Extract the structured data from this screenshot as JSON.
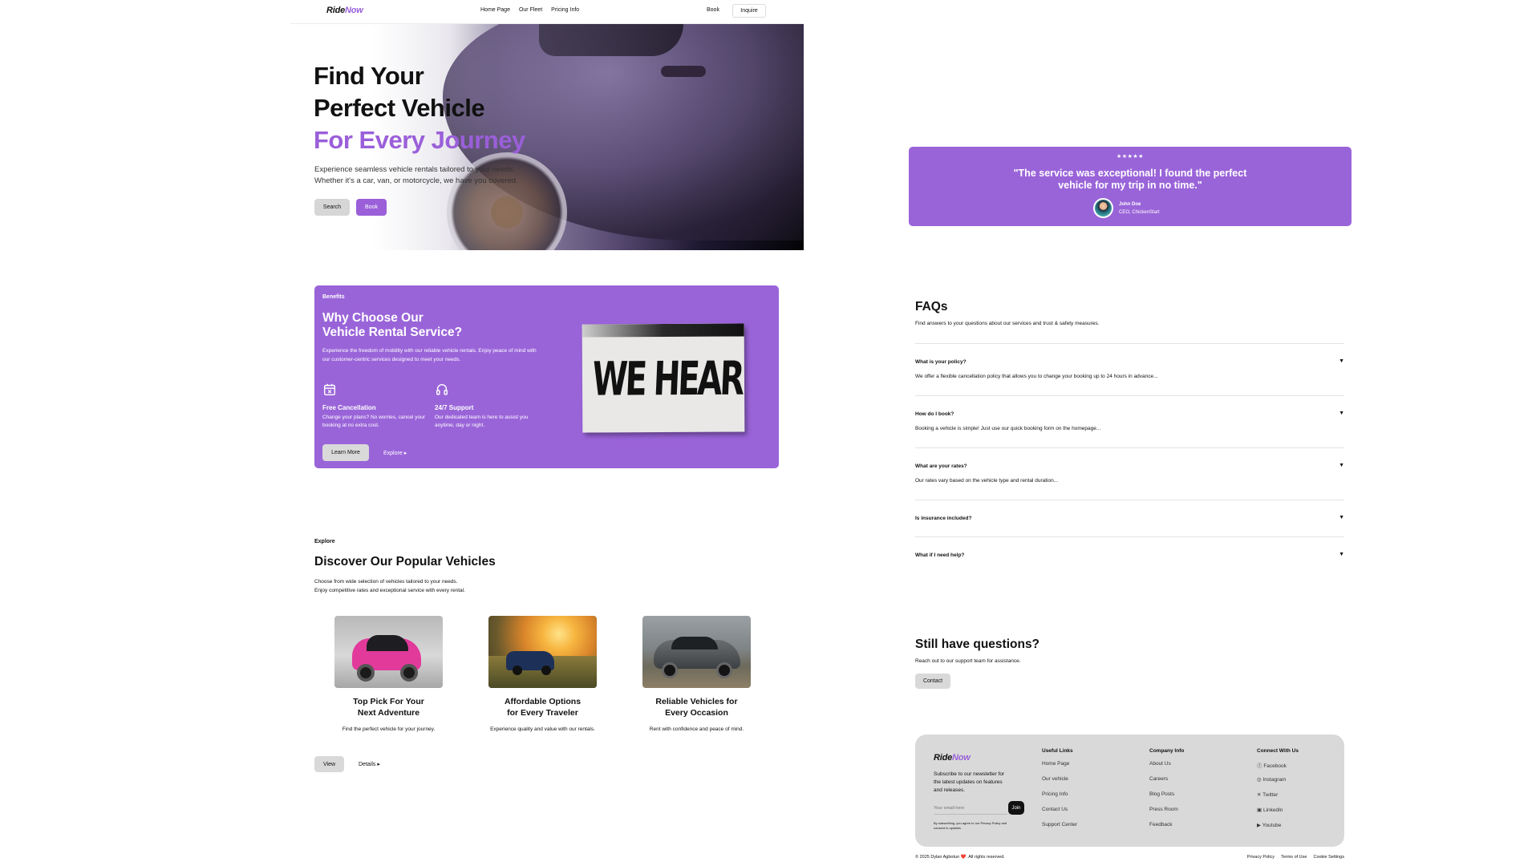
{
  "nav": {
    "logo_ride": "Ride",
    "logo_now": "Now",
    "links": [
      "Home Page",
      "Our Fleet",
      "Pricing Info"
    ],
    "book": "Book",
    "inquire": "Inquire"
  },
  "hero": {
    "line1": "Find Your",
    "line2": "Perfect Vehicle",
    "line3": "For Every Journey",
    "sub1": "Experience seamless vehicle rentals tailored to your needs.",
    "sub2": "Whether it's a car, van, or motorcycle, we have you covered.",
    "search": "Search",
    "book": "Book"
  },
  "testimonial": {
    "stars": "★★★★★",
    "quote": "\"The service was exceptional! I found the perfect vehicle for my trip in no time.\"",
    "name": "John Doe",
    "role": "CEO, ChickenStart"
  },
  "benefits": {
    "eyebrow": "Benefits",
    "title1": "Why Choose Our",
    "title2": "Vehicle Rental Service?",
    "desc": "Experience the freedom of mobility with our reliable vehicle rentals. Enjoy peace of mind with our customer-centric services designed to meet your needs.",
    "feature1": {
      "title": "Free Cancellation",
      "text": "Change your plans? No worries, cancel your booking at no extra cost.",
      "icon": "calendar-x-icon"
    },
    "feature2": {
      "title": "24/7 Support",
      "text": "Our dedicated team is here to assist you anytime, day or night.",
      "icon": "headset-icon"
    },
    "learn_more": "Learn More",
    "explore": "Explore",
    "image_text": "WE HEAR YOU."
  },
  "popular": {
    "eyebrow": "Explore",
    "title": "Discover Our Popular Vehicles",
    "desc1": "Choose from wide selection of vehicles tailored to your needs.",
    "desc2": "Enjoy competitive rates and exceptional service with every rental.",
    "cards": [
      {
        "title1": "Top Pick For Your",
        "title2": "Next Adventure",
        "text": "Find the perfect vehicle for your journey."
      },
      {
        "title1": "Affordable Options",
        "title2": "for Every Traveler",
        "text": "Experience quality and value with our rentals."
      },
      {
        "title1": "Reliable Vehicles for",
        "title2": "Every Occasion",
        "text": "Rent with confidence and peace of mind."
      }
    ],
    "view": "View",
    "details": "Details"
  },
  "faq": {
    "title": "FAQs",
    "desc": "Find answers to your questions about our services and trust & safety measures.",
    "items": [
      {
        "q": "What is your policy?",
        "a": "We offer a flexible cancellation policy that allows you to change your booking up to 24 hours in advance..."
      },
      {
        "q": "How do I book?",
        "a": "Booking a vehicle is simple! Just use our quick booking form on the homepage..."
      },
      {
        "q": "What are your rates?",
        "a": "Our rates vary based on the vehicle type and rental duration..."
      },
      {
        "q": "Is insurance included?",
        "a": ""
      },
      {
        "q": "What if I need help?",
        "a": ""
      }
    ]
  },
  "still": {
    "title": "Still have questions?",
    "desc": "Reach out to our support team for assistance.",
    "contact": "Contact"
  },
  "footer": {
    "newsletter": "Subscribe to our newsletter for the latest updates on features and releases.",
    "email_placeholder": "Your email here",
    "join": "Join",
    "note": "By subscribing, you agree to our Privacy Policy and consent to updates.",
    "useful_title": "Useful Links",
    "useful": [
      "Home Page",
      "Our vehicle",
      "Pricing Info",
      "Contact Us",
      "Support Center"
    ],
    "company_title": "Company Info",
    "company": [
      "About Us",
      "Careers",
      "Blog Posts",
      "Press Room",
      "Feedback"
    ],
    "connect_title": "Connect With Us",
    "connect": [
      "Facebook",
      "Instagram",
      "Twitter",
      "LinkedIn",
      "Youtube"
    ],
    "copyright": "© 2025 Dylan Agbotun ❤️. All rights reserved.",
    "legal": [
      "Privacy Policy",
      "Terms of Use",
      "Cookie Settings"
    ]
  },
  "colors": {
    "accent": "#9a5fd9",
    "card_purple": "#9a64d9",
    "footer_grey": "#d9d9d9"
  }
}
